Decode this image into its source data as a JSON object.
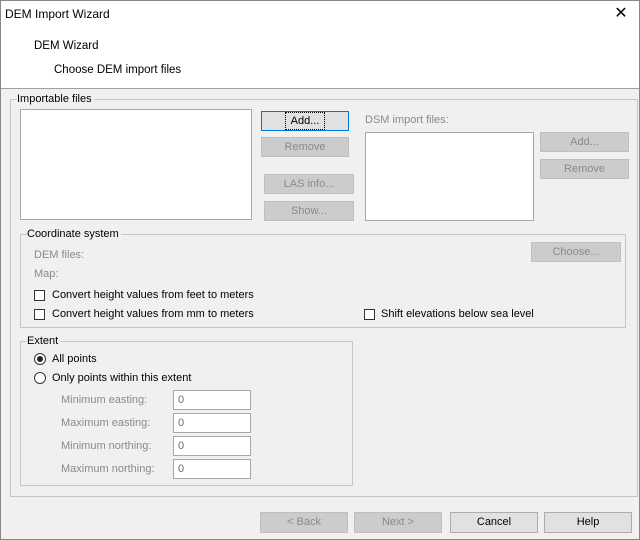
{
  "window": {
    "title": "DEM Import Wizard"
  },
  "header": {
    "title": "DEM Wizard",
    "subtitle": "Choose DEM import files"
  },
  "importable": {
    "legend": "Importable files",
    "add": "Add...",
    "remove": "Remove",
    "las_info": "LAS info...",
    "show": "Show...",
    "dsm_label": "DSM import files:",
    "dsm_add": "Add...",
    "dsm_remove": "Remove"
  },
  "coord": {
    "legend": "Coordinate system",
    "dem_files": "DEM files:",
    "map": "Map:",
    "choose": "Choose...",
    "feet_to_meters": "Convert height values from feet to meters",
    "mm_to_meters": "Convert height values from mm to meters",
    "shift_elev": "Shift elevations below sea level",
    "feet_checked": false,
    "mm_checked": false,
    "shift_checked": false
  },
  "extent": {
    "legend": "Extent",
    "all_points": "All points",
    "within_extent": "Only points within this extent",
    "selected": "all_points",
    "min_easting_label": "Minimum easting:",
    "max_easting_label": "Maximum easting:",
    "min_northing_label": "Minimum northing:",
    "max_northing_label": "Maximum northing:",
    "min_easting": "0",
    "max_easting": "0",
    "min_northing": "0",
    "max_northing": "0"
  },
  "footer": {
    "back": "< Back",
    "next": "Next >",
    "cancel": "Cancel",
    "help": "Help"
  }
}
